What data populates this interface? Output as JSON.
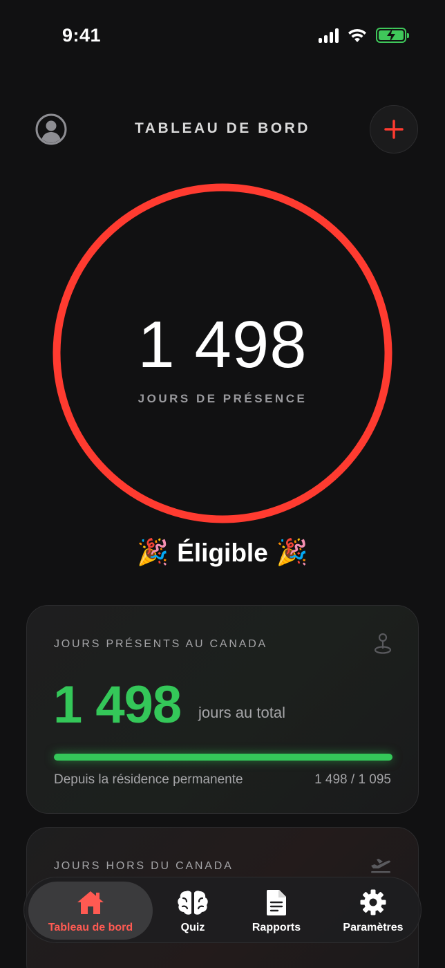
{
  "status_bar": {
    "time": "9:41"
  },
  "header": {
    "title": "TABLEAU DE BORD"
  },
  "ring": {
    "count": "1 498",
    "label": "JOURS DE PRÉSENCE",
    "progress": 1.0
  },
  "eligible": {
    "left_emoji": "🎉",
    "text": "Éligible",
    "right_emoji": "🎉"
  },
  "card_present": {
    "title": "JOURS PRÉSENTS AU CANADA",
    "count": "1 498",
    "unit": "jours au total",
    "progress": 1.0,
    "footer_left": "Depuis la résidence permanente",
    "footer_right": "1 498 / 1 095",
    "icon": "map-pin-icon"
  },
  "card_absent": {
    "title": "JOURS HORS DU CANADA",
    "icon": "airplane-departure-icon"
  },
  "tabs": [
    {
      "label": "Tableau de bord",
      "icon": "home-icon",
      "active": true
    },
    {
      "label": "Quiz",
      "icon": "brain-icon",
      "active": false
    },
    {
      "label": "Rapports",
      "icon": "document-icon",
      "active": false
    },
    {
      "label": "Paramètres",
      "icon": "gear-icon",
      "active": false
    }
  ],
  "colors": {
    "accent_red": "#ff3b30",
    "accent_green": "#34c759",
    "background": "#111112"
  }
}
